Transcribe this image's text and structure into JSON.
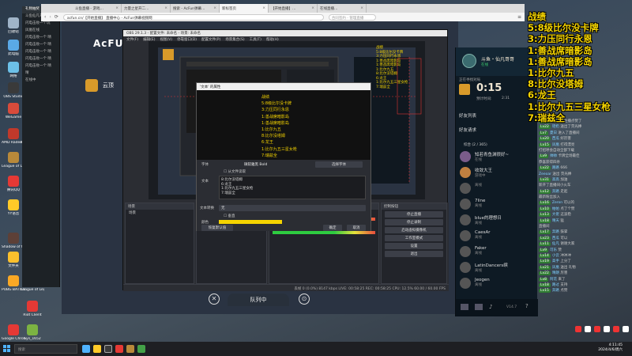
{
  "desktop": {
    "icons": [
      {
        "label": "回收站",
        "color": "#9fb4c8"
      },
      {
        "label": "此电脑",
        "color": "#5aa9e6"
      },
      {
        "label": "网络",
        "color": "#6cc0e8"
      },
      {
        "label": "OBS Studio",
        "color": "#3a3a3a"
      },
      {
        "label": "WeGame",
        "color": "#d84b3b"
      },
      {
        "label": "AMD Radeon Software",
        "color": "#c0392b"
      },
      {
        "label": "Microsoft Edge",
        "color": "#1e88e5"
      },
      {
        "label": "League of Legends",
        "color": "#b8893a"
      },
      {
        "label": "Steam",
        "color": "#1b2838"
      },
      {
        "label": "腾讯QQ",
        "color": "#e53935"
      },
      {
        "label": "微信",
        "color": "#43a047"
      },
      {
        "label": "YY语音",
        "color": "#ffca28"
      },
      {
        "label": "Shadow of the Tomb",
        "color": "#5d4037"
      },
      {
        "label": "20230422",
        "color": "#fbc02d"
      },
      {
        "label": "文件夹",
        "color": "#fbc02d"
      },
      {
        "label": "PUBG BATTLEGROUNDS",
        "color": "#f9a825"
      },
      {
        "label": "League of Legends",
        "color": "#3949ab"
      },
      {
        "label": "Riot Client",
        "color": "#e53935"
      },
      {
        "label": "Google Chrome",
        "color": "#e53935"
      },
      {
        "label": "Sys_1652",
        "color": "#7cb342"
      }
    ],
    "chat_window": {
      "title": "礼物抽奖",
      "rows": [
        "斗鱼仙凡哥哥",
        "闪电击败一个玩",
        "凤凰在线",
        "闪电击败一个 晴",
        "闪电击败一个 晴",
        "闪电击败一个 晴",
        "闪电击败一个 晴",
        "闪电击败一个 晴",
        "晴",
        "在线中"
      ]
    }
  },
  "browser": {
    "tabs": [
      {
        "label": "斗鱼直播 - 游戏…",
        "active": false
      },
      {
        "label": "力量之星开二…",
        "active": false
      },
      {
        "label": "搜索 - AcFun弹幕…",
        "active": false
      },
      {
        "label": "新标签页",
        "active": true
      },
      {
        "label": "【开始直播】…",
        "active": false
      },
      {
        "label": "在线直播…",
        "active": false
      }
    ],
    "address": "acfun.cn/【开始直播】 直播中心 - AcFun弹幕视频网",
    "search_placeholder": "合同签约 - 管理直播"
  },
  "acfun": {
    "logo": "AcFUN 肿胀",
    "card_label": "云顶"
  },
  "obs": {
    "title": "OBS 29.1.3 - 配置文件: 未命名 - 场景: 未命名",
    "menu": [
      "文件(F)",
      "编辑(E)",
      "视图(V)",
      "停靠窗口(D)",
      "配置文件(P)",
      "场景集合(S)",
      "工具(T)",
      "帮助(H)"
    ],
    "docks": {
      "scenes": {
        "header": "场景",
        "items": [
          "场景"
        ]
      },
      "sources": {
        "header": "来源",
        "items": [
          "文本(GDI+)",
          "显示器采集",
          "音频输入采集"
        ]
      },
      "mixer": {
        "header": "混音器",
        "channels": [
          "桌面音频",
          "麦克风/Aux"
        ]
      },
      "controls": {
        "header": "控制按钮",
        "buttons": [
          "停止直播",
          "停止录制",
          "启动虚拟摄像机",
          "工作室模式",
          "设置",
          "退出"
        ]
      }
    },
    "status": "丢帧 0 (0.0%)    8147 kbps    LIVE: 00:58:25    REC: 00:58:25    CPU: 12.5%    60.00 / 60.00 FPS"
  },
  "dialog": {
    "title": "'文本' 的属性",
    "preview_lines": [
      "战绩",
      "5:8级比尔没卡牌",
      "3:力压同行永恩",
      "1:善战席暗影岛",
      "1:善战席暗影岛",
      "1:比尔九五",
      "8:比尔没塔姆",
      "6:龙王",
      "1:比尔九五三星女枪",
      "7:瑞兹全"
    ],
    "form": {
      "label_font": "字体",
      "font_value": "微软雅黑  Bold",
      "font_button": "选择字体",
      "label_text": "文本",
      "from_file": "从文件读取",
      "text_value": "8:比尔没塔姆\n6:龙王\n1:比尔九五三星女枪\n7:瑞兹全",
      "label_antialias": "文本转换",
      "antialias_value": "无",
      "vertical": "垂直",
      "label_color": "颜色",
      "color_button": "选择颜色",
      "defaults": "恢复默认值",
      "ok": "确定",
      "cancel": "取消"
    }
  },
  "annotation": {
    "lines": [
      "战绩",
      "5:8级比尔没卡牌",
      "3:力压同行永恩",
      "1:善战席暗影岛",
      "1:善战席暗影岛",
      "1:比尔九五",
      "8:比尔没塔姆",
      "6:龙王",
      "1:比尔九五三星女枪",
      "7:瑞兹全"
    ]
  },
  "queue": {
    "label": "队列中",
    "close": "✕",
    "other": "⊙"
  },
  "client": {
    "user_name": "斗鱼・仙凡哥哥",
    "user_status": "在线",
    "queue_title": "正在寻找对局",
    "timer": "0:15",
    "est_label": "预计时间:",
    "est_value": "2:31",
    "friends_header": "好友列表",
    "friend_requests": "好友请求",
    "group_label": "综合 (2 / 365)",
    "friends": [
      {
        "name": "知若青鱼渊很好~",
        "status": "在线",
        "color": "#7a5c8a"
      },
      {
        "name": "收敛大王",
        "status": "游戏中",
        "color": "#c08040"
      },
      {
        "name": "",
        "status": "离线",
        "color": "#555"
      },
      {
        "name": "7line",
        "status": "离线",
        "color": "#555"
      },
      {
        "name": "blue的理想日",
        "status": "离线",
        "color": "#555"
      },
      {
        "name": "CaesAr",
        "status": "离线",
        "color": "#555"
      },
      {
        "name": "Faker",
        "status": "离线",
        "color": "#555"
      },
      {
        "name": "LatinDancers缤",
        "status": "离线",
        "color": "#555"
      },
      {
        "name": "Jeogen",
        "status": "离线",
        "color": "#555"
      }
    ],
    "version": "V14.7"
  },
  "feed": {
    "rows": [
      {
        "tag": "Lv18",
        "name": "奔路",
        "text": " 为主播点赞了"
      },
      {
        "tag": "Lv22",
        "name": "瑶奶",
        "text": " 送出了荧光棒"
      },
      {
        "tag": "Lv7",
        "name": "夏日",
        "text": " 进入了直播间"
      },
      {
        "tag": "Lv20",
        "name": "西瓜",
        "text": " 好厉害"
      },
      {
        "tag": "Lv15",
        "name": "凤凰",
        "text": " 打得漂亮"
      },
      {
        "tag": "",
        "name": "",
        "text": "打招呼会自动全部下载"
      },
      {
        "tag": "Lv9",
        "name": "帅帅",
        "text": " 卡牌全场最佳"
      },
      {
        "tag": "",
        "name": "",
        "text": "恭喜获得四杀"
      },
      {
        "tag": "Lv22",
        "name": "路路",
        "text": " 666"
      },
      {
        "tag": "",
        "name": "Zeeoar",
        "text": " 送出 荧光棒"
      },
      {
        "tag": "Lv31",
        "name": "高高",
        "text": " 加油"
      },
      {
        "tag": "",
        "name": "",
        "text": "新开了直播间小火车"
      },
      {
        "tag": "Lv12",
        "name": "奔路",
        "text": " 走起"
      },
      {
        "tag": "",
        "name": "",
        "text": "最新粉丝加入"
      },
      {
        "tag": "Lv16",
        "name": "Zeron",
        "text": " 可以的"
      },
      {
        "tag": "Lv10",
        "name": "帕帕",
        "text": " 点了个赞"
      },
      {
        "tag": "Lv13",
        "name": "大佬",
        "text": " 这波稳"
      },
      {
        "tag": "Lv18",
        "name": "晴天",
        "text": " 猛"
      },
      {
        "tag": "",
        "name": "",
        "text": "直播间"
      },
      {
        "tag": "Lv17",
        "name": "奔路",
        "text": " 鼓掌"
      },
      {
        "tag": "Lv23",
        "name": "西瓜",
        "text": " 可以"
      },
      {
        "tag": "Lv11",
        "name": "仙凡",
        "text": " 谢谢大家"
      },
      {
        "tag": "Lv9",
        "name": "可乐",
        "text": " 赞"
      },
      {
        "tag": "Lv14",
        "name": "小云",
        "text": " 冲冲冲"
      },
      {
        "tag": "Lv19",
        "name": "高手",
        "text": " 上分了"
      },
      {
        "tag": "Lv21",
        "name": "凤凰",
        "text": " 送出 礼物"
      },
      {
        "tag": "Lv22",
        "name": "晴朗",
        "text": " 厉害"
      },
      {
        "tag": "Lv8",
        "name": "阿花",
        "text": " 来了"
      },
      {
        "tag": "Lv18",
        "name": "路过",
        "text": " 支持"
      },
      {
        "tag": "Lv15",
        "name": "奔路",
        "text": " 点赞"
      }
    ]
  },
  "stats": {
    "lines": [
      "战绩",
      "5:8级比尔没卡牌",
      "3:力压同行永恩",
      "1:善战席暗影岛",
      "1:善战席暗影岛",
      "1:比尔九五",
      "8:比尔没塔姆",
      "6:龙王",
      "1:比尔九五三星女枪",
      "7:瑞兹全"
    ]
  },
  "taskbar": {
    "search_placeholder": "搜索",
    "time": "4:11:45",
    "date": "2024/4/6/周六"
  },
  "colors": {
    "accent_yellow": "#f5d400",
    "client_bg": "#0e1a24",
    "obs_bg": "#2b2d33"
  }
}
